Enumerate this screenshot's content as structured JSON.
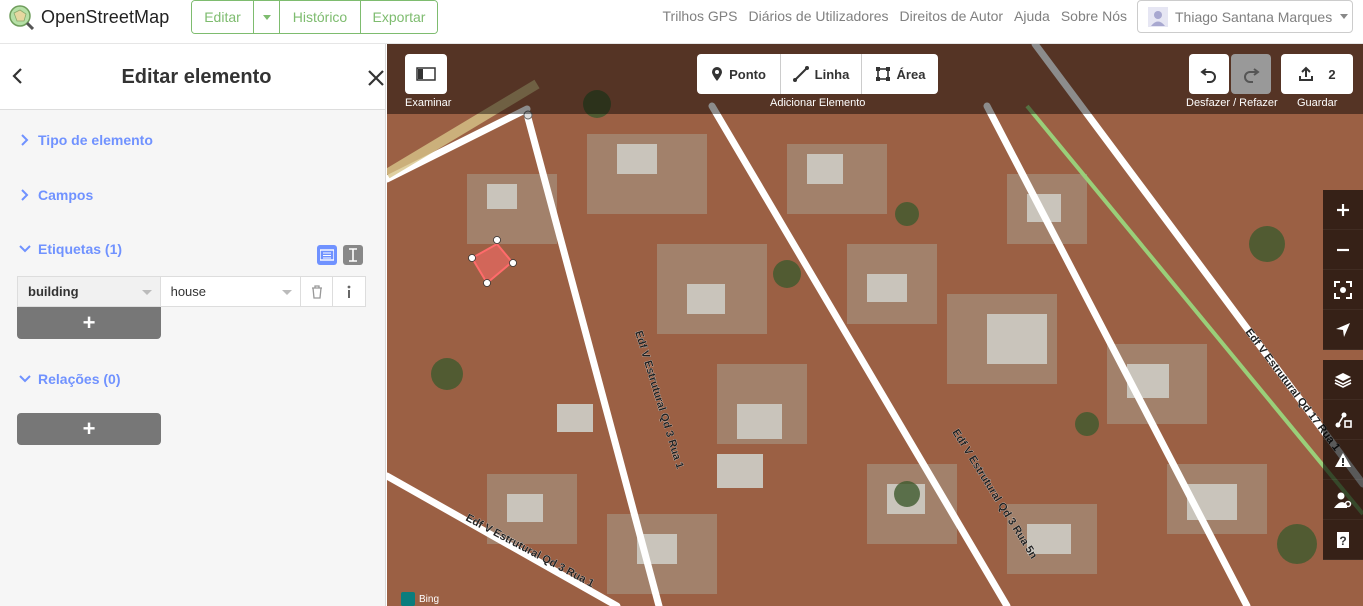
{
  "header": {
    "brand": "OpenStreetMap",
    "nav": {
      "edit": "Editar",
      "history": "Histórico",
      "export": "Exportar"
    },
    "secondary_nav": [
      "Trilhos GPS",
      "Diários de Utilizadores",
      "Direitos de Autor",
      "Ajuda",
      "Sobre Nós"
    ],
    "user": "Thiago Santana Marques"
  },
  "sidebar": {
    "title": "Editar elemento",
    "sections": {
      "type": "Tipo de elemento",
      "fields": "Campos",
      "tags": "Etiquetas (1)",
      "relations": "Relações (0)"
    },
    "tag": {
      "key": "building",
      "value": "house"
    },
    "add_symbol": "+"
  },
  "map": {
    "toolbar": {
      "browse_label": "Examinar",
      "point": "Ponto",
      "line": "Linha",
      "area": "Área",
      "add_label": "Adicionar Elemento",
      "undo_label": "Desfazer / Refazer",
      "save_label": "Guardar",
      "save_count": "2"
    },
    "streets": [
      "Edf V Estrutural Qd 3 Rua 1",
      "Edf V Estrutural Qd 3 Rua 5n",
      "Edf V Estrutural Qd 17 Rua 1",
      "Edf V Estrutural Qd 3 Rua 1"
    ],
    "attribution": "Bing",
    "colors": {
      "accent": "#7ebc6f",
      "link": "#7092ff",
      "selection": "#ff6b6b"
    }
  }
}
